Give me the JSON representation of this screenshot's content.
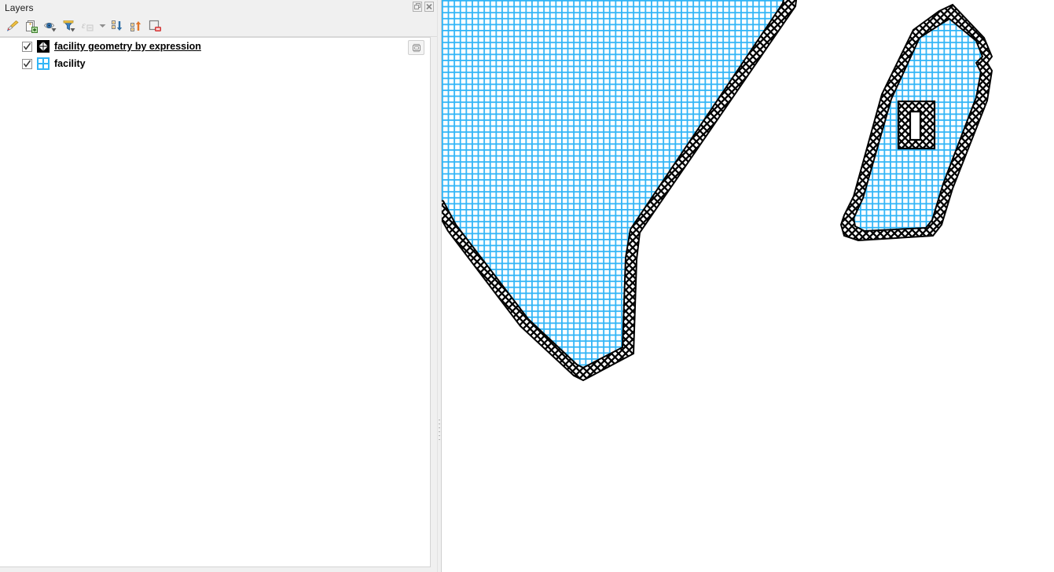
{
  "panel": {
    "title": "Layers",
    "titlebar_buttons": [
      {
        "name": "undock-button",
        "icon": "float-icon"
      },
      {
        "name": "close-button",
        "icon": "close-icon"
      }
    ],
    "toolbar": [
      {
        "name": "open-layer-styling-panel",
        "icon": "paintbrush-icon",
        "enabled": true
      },
      {
        "name": "add-group",
        "icon": "add-group-icon",
        "enabled": true
      },
      {
        "name": "manage-map-themes",
        "icon": "eye-icon",
        "enabled": true
      },
      {
        "name": "filter-legend-by-map-content",
        "icon": "filter-icon",
        "enabled": true
      },
      {
        "name": "filter-legend-by-expression",
        "icon": "expression-filter-icon",
        "enabled": false
      },
      {
        "name": "filter-legend-dropdown",
        "icon": "chevron-down-icon",
        "enabled": true
      },
      {
        "name": "expand-all",
        "icon": "expand-all-icon",
        "enabled": true
      },
      {
        "name": "collapse-all",
        "icon": "collapse-all-icon",
        "enabled": true
      },
      {
        "name": "remove-layer-group",
        "icon": "remove-layer-icon",
        "enabled": true
      }
    ],
    "layers": [
      {
        "name": "facility geometry by expression",
        "checked": true,
        "symbol": "crosshatch-polygon-symbol",
        "selected": true,
        "underlined": true,
        "row_action": "processing-algorithm-icon"
      },
      {
        "name": "facility",
        "checked": true,
        "symbol": "cyan-grid-polygon-symbol",
        "selected": false,
        "underlined": false,
        "row_action": null
      }
    ]
  },
  "map": {
    "background_color": "#ffffff",
    "fill_color": "#31b5f7",
    "outline_color": "#000000",
    "features": [
      {
        "name": "main-polygon",
        "description": "Large polygon extending beyond top edge, tapering to a point at lower-left"
      },
      {
        "name": "island-polygon",
        "description": "Smaller polygon in lower-right with rectangular inner hole"
      },
      {
        "name": "inner-hole-rectangle",
        "description": "Small hatched rectangle containing a narrow vertical slot"
      }
    ]
  }
}
